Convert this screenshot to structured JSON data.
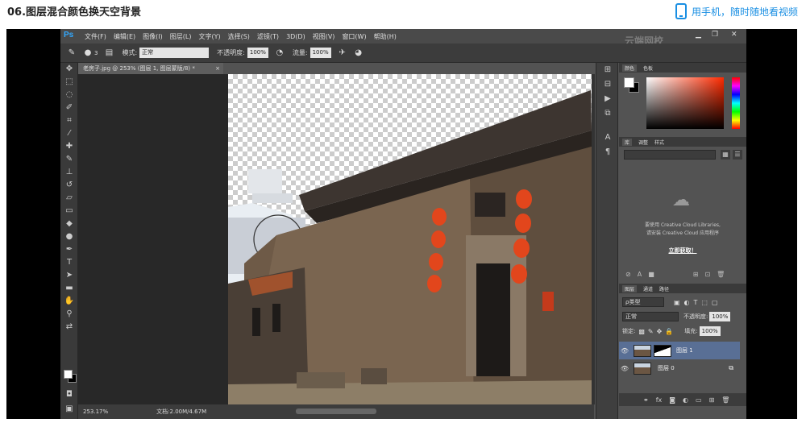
{
  "page": {
    "title": "06.图层混合颜色换天空背景",
    "mobile_link": "用手机，随时随地看视频"
  },
  "ps": {
    "logo": "Ps",
    "menu": [
      "文件(F)",
      "编辑(E)",
      "图像(I)",
      "图层(L)",
      "文字(Y)",
      "选择(S)",
      "滤镜(T)",
      "3D(D)",
      "视图(V)",
      "窗口(W)",
      "帮助(H)"
    ],
    "window_controls": {
      "minimize": "▁",
      "restore": "❐",
      "close": "✕"
    },
    "options": {
      "brush_size": "3",
      "mode_label": "模式:",
      "mode_value": "正常",
      "opacity_label": "不透明度:",
      "opacity_value": "100%",
      "flow_label": "流量:",
      "flow_value": "100%"
    },
    "document_tab": "老房子.jpg @ 253% (图层 1, 图层蒙版/8) *",
    "document_tab_close": "×",
    "status": {
      "zoom": "253.17%",
      "doc_info": "文档:2.00M/4.67M"
    }
  },
  "panels": {
    "color_tabs": [
      "颜色",
      "色板"
    ],
    "library_tabs": [
      "库",
      "调整",
      "样式"
    ],
    "library_message_1": "要使用 Creative Cloud Libraries,",
    "library_message_2": "请安装 Creative Cloud 应用程序",
    "library_link": "立即获取！",
    "layers_tabs": [
      "图层",
      "通道",
      "路径"
    ],
    "layers": {
      "filter_label": "ρ类型",
      "blend_mode": "正常",
      "opacity_label": "不透明度:",
      "opacity_value": "100%",
      "lock_label": "锁定:",
      "fill_label": "填充:",
      "fill_value": "100%",
      "items": [
        {
          "name": "图层 1",
          "selected": true
        },
        {
          "name": "图层 0",
          "selected": false
        }
      ]
    }
  },
  "watermark": "云端网校",
  "colors": {
    "accent_link": "#1a8fe3",
    "ps_bg": "#535353",
    "layer_selected": "#596f95",
    "lantern": "#e2461c"
  }
}
